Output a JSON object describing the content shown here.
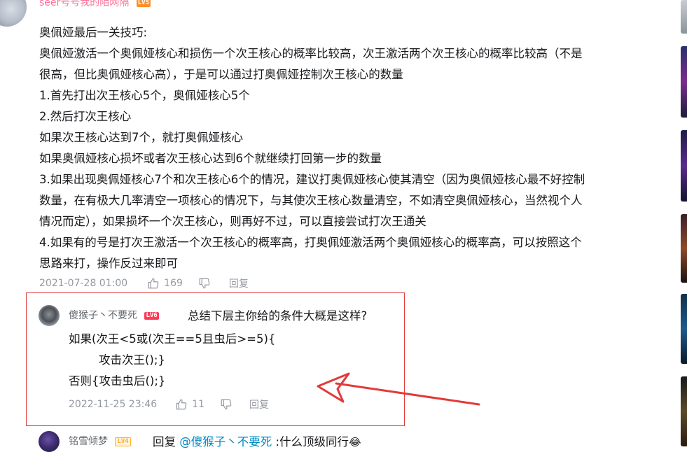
{
  "top_comment": {
    "username": "seer号号我的陌网隔",
    "level": "LV5",
    "lines": [
      "奥佩娅最后一关技巧:",
      "奥佩娅激活一个奥佩娅核心和损伤一个次王核心的概率比较高，次王激活两个次王核心的概率比较高（不是",
      "很高，但比奥佩娅核心高），于是可以通过打奥佩娅控制次王核心的数量",
      "1.首先打出次王核心5个，奥佩娅核心5个",
      "2.然后打次王核心",
      "如果次王核心达到7个，就打奥佩娅核心",
      "如果奥佩娅核心损坏或者次王核心达到6个就继续打回第一步的数量",
      "3.如果出现奥佩娅核心7个和次王核心6个的情况，建议打奥佩娅核心使其清空（因为奥佩娅核心最不好控制",
      "数量，在有极大几率清空一项核心的情况下，与其使次王核心数量清空，不如清空奥佩娅核心，当然视个人",
      "情况而定），如果损坏一个次王核心，则再好不过，可以直接尝试打次王通关",
      "4.如果有的号是打次王激活一个次王核心的概率高，打奥佩娅激活两个奥佩娅核心的概率高，可以按照这个",
      "思路来打，操作反过来即可"
    ],
    "date": "2021-07-28 01:00",
    "likes": "169",
    "reply_label": "回复"
  },
  "reply_1": {
    "username": "傻猴子丶不要死",
    "level": "LV6",
    "text": "总结下层主你给的条件大概是这样?",
    "code_lines": [
      "如果(次王<5或(次王==5且虫后>=5){",
      "攻击次王();}",
      "否则{攻击虫后();}"
    ],
    "date": "2022-11-25 23:46",
    "likes": "11",
    "reply_label": "回复"
  },
  "reply_2": {
    "username": "铭雪倾梦",
    "level": "LV4",
    "prefix": "回复 ",
    "mention": "@傻猴子丶不要死",
    "text": " :什么顶级同行",
    "emoji": "😂"
  },
  "colors": {
    "username_pink": "#fb7299",
    "mention_blue": "#008ac5",
    "highlight_red": "#e23a3a",
    "meta_gray": "#9499a0"
  }
}
